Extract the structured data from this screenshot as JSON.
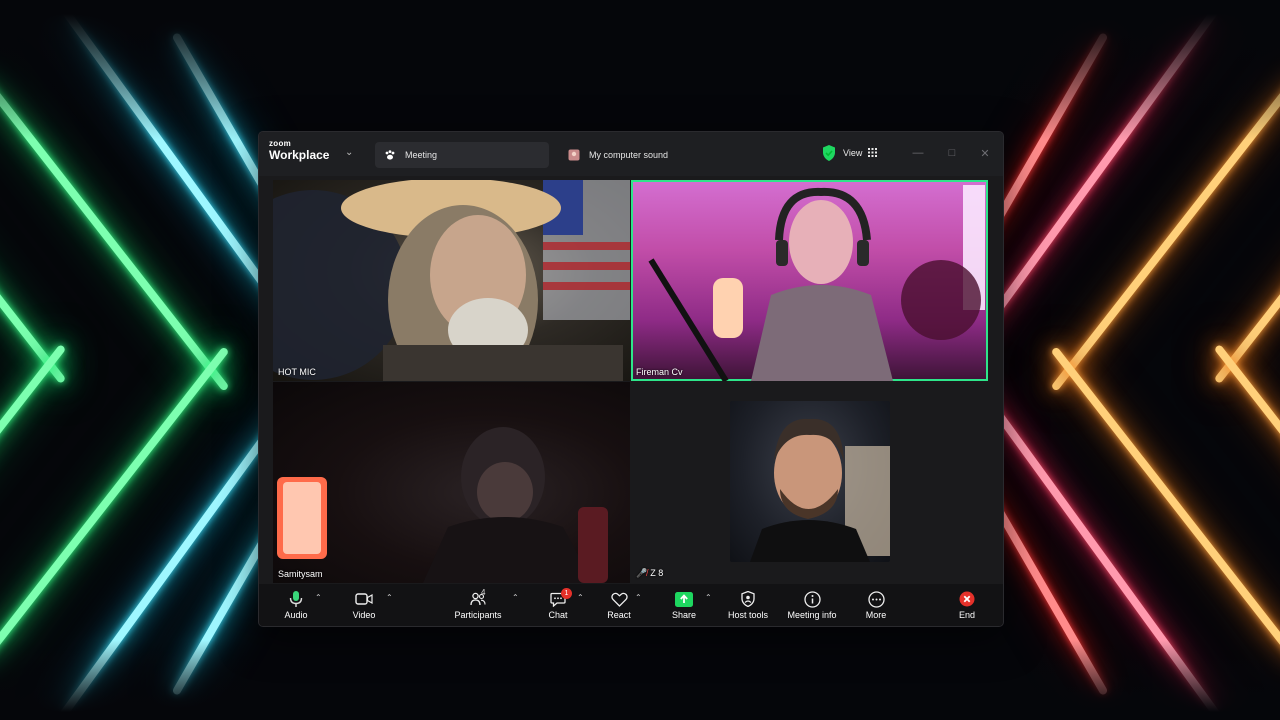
{
  "app": {
    "brand_small": "zoom",
    "brand_name": "Workplace"
  },
  "tabs": [
    {
      "label": "Meeting"
    },
    {
      "label": "My computer sound"
    }
  ],
  "header": {
    "view_label": "View"
  },
  "participants": [
    {
      "name": "HOT MIC"
    },
    {
      "name": "Fireman Cv"
    },
    {
      "name": "Samitysam"
    },
    {
      "name": "Z 8",
      "muted": true
    }
  ],
  "toolbar": {
    "audio": "Audio",
    "video": "Video",
    "participants": "Participants",
    "participants_count": "4",
    "chat": "Chat",
    "chat_badge": "1",
    "react": "React",
    "share": "Share",
    "host_tools": "Host tools",
    "meeting_info": "Meeting info",
    "more": "More",
    "end": "End"
  },
  "colors": {
    "active_speaker_border": "#2ee58a",
    "share_green": "#1ed760",
    "end_red": "#e5312a",
    "mic_green": "#39d67a"
  }
}
